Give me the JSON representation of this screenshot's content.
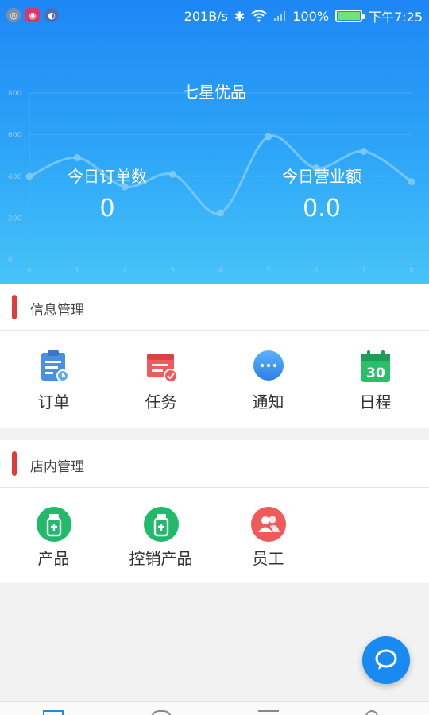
{
  "statusbar": {
    "speed": "201B/s",
    "battery": "100%",
    "battery_level": 1.0,
    "time": "下午7:25",
    "icons": [
      "bluetooth-icon",
      "wifi-icon",
      "signal-icon",
      "battery-icon"
    ]
  },
  "header": {
    "title": "七星优品",
    "orders_label": "今日订单数",
    "orders_value": "0",
    "revenue_label": "今日营业额",
    "revenue_value": "0.0"
  },
  "chart_data": {
    "type": "line",
    "x": [
      0,
      1,
      2,
      3,
      4,
      5,
      6,
      7,
      8
    ],
    "y_ticks": [
      0,
      200,
      400,
      600,
      800
    ],
    "values": [
      400,
      490,
      350,
      410,
      225,
      590,
      440,
      520,
      375
    ],
    "ylim": [
      0,
      800
    ],
    "xlim": [
      0,
      8
    ],
    "grid": true,
    "colors": {
      "line": "#7fcaf6",
      "grid": "#5ab3f8",
      "tick": "#8ccaf8"
    }
  },
  "info_section": {
    "title": "信息管理",
    "items": [
      {
        "label": "订单",
        "icon": "clipboard-icon",
        "color": "#4a90e2"
      },
      {
        "label": "任务",
        "icon": "task-icon",
        "color": "#ef5a5a"
      },
      {
        "label": "通知",
        "icon": "chat-bubble-icon",
        "color": "#2d8ff0"
      },
      {
        "label": "日程",
        "icon": "calendar-icon",
        "color": "#2bbf6a",
        "number": "30"
      }
    ]
  },
  "store_section": {
    "title": "店内管理",
    "items": [
      {
        "label": "产品",
        "icon": "bottle-icon",
        "color": "#21b96a"
      },
      {
        "label": "控销产品",
        "icon": "bottle-icon",
        "color": "#21b96a"
      },
      {
        "label": "员工",
        "icon": "staff-icon",
        "color": "#ef5a5a"
      }
    ]
  },
  "fab": {
    "icon": "chat-icon",
    "color": "#1a8af3"
  },
  "accent": "#e23b3b"
}
